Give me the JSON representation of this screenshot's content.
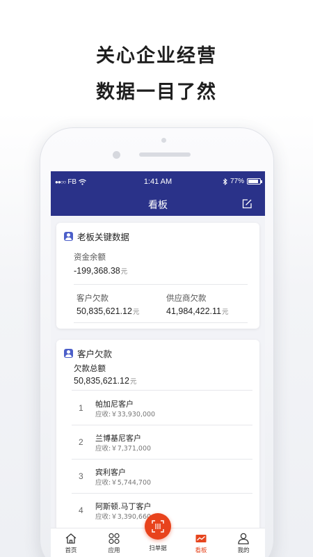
{
  "promo": {
    "line1": "关心企业经营",
    "line2": "数据一目了然"
  },
  "status_bar": {
    "signal": "●●○○",
    "carrier": "FB",
    "time": "1:41 AM",
    "battery": "77%"
  },
  "nav": {
    "title": "看板"
  },
  "boss_card": {
    "title": "老板关键数据",
    "cash_label": "资金余额",
    "cash_value": "-199,368.38",
    "cash_unit": "元",
    "receivable_label": "客户欠款",
    "receivable_value": "50,835,621.12",
    "receivable_unit": "元",
    "payable_label": "供应商欠款",
    "payable_value": "41,984,422.11",
    "payable_unit": "元"
  },
  "debt_card": {
    "title": "客户欠款",
    "total_label": "欠款总额",
    "total_value": "50,835,621.12",
    "total_unit": "元",
    "rows": [
      {
        "index": "1",
        "name": "帕加尼客户",
        "amount": "应收:￥33,930,000"
      },
      {
        "index": "2",
        "name": "兰博基尼客户",
        "amount": "应收:￥7,371,000"
      },
      {
        "index": "3",
        "name": "宾利客户",
        "amount": "应收:￥5,744,700"
      },
      {
        "index": "4",
        "name": "阿斯顿.马丁客户",
        "amount": "应收:￥3,390,660"
      }
    ]
  },
  "tabbar": {
    "home": "首页",
    "apps": "应用",
    "scan": "扫单据",
    "board": "看板",
    "mine": "我的",
    "active_color": "#e6451e"
  },
  "colors": {
    "nav_bg": "#2a3289",
    "accent": "#e8431c"
  }
}
